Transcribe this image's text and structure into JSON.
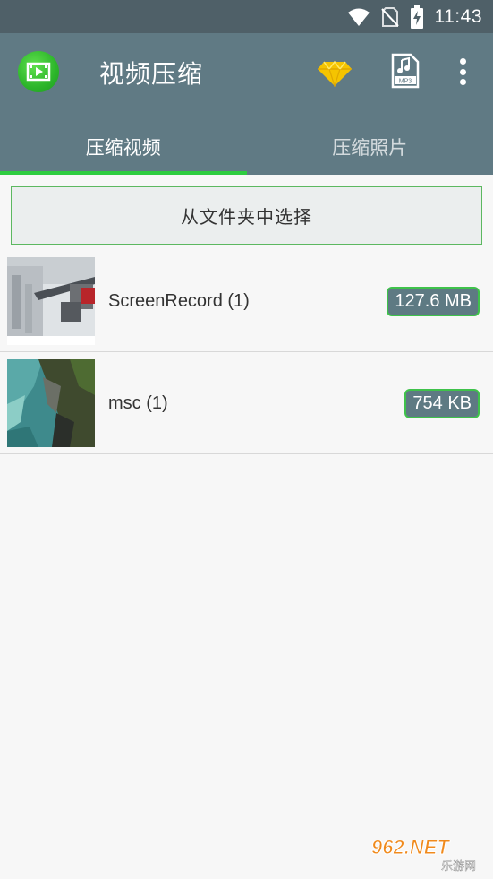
{
  "status_bar": {
    "time": "11:43",
    "icons": [
      "wifi-icon",
      "no-sim-icon",
      "battery-charging-icon"
    ]
  },
  "app_bar": {
    "title": "视频压缩",
    "logo_icon": "video-compress-logo",
    "actions": [
      "premium-diamond-icon",
      "mp3-file-icon",
      "more-vert-icon"
    ],
    "mp3_label": "MP3"
  },
  "tabs": [
    {
      "label": "压缩视频",
      "active": true
    },
    {
      "label": "压缩照片",
      "active": false
    }
  ],
  "select_button": {
    "label": "从文件夹中选择"
  },
  "videos": [
    {
      "name": "ScreenRecord (1)",
      "size": "127.6 MB"
    },
    {
      "name": "msc (1)",
      "size": "754 KB"
    }
  ],
  "watermark": {
    "text": "962.NET",
    "subtext": "乐游网"
  },
  "colors": {
    "status_bar": "#4f6068",
    "app_bar": "#607a84",
    "tab_indicator": "#2ecc40",
    "badge_bg": "#5e7a83",
    "badge_border": "#3fc24b",
    "background": "#f7f7f7"
  }
}
